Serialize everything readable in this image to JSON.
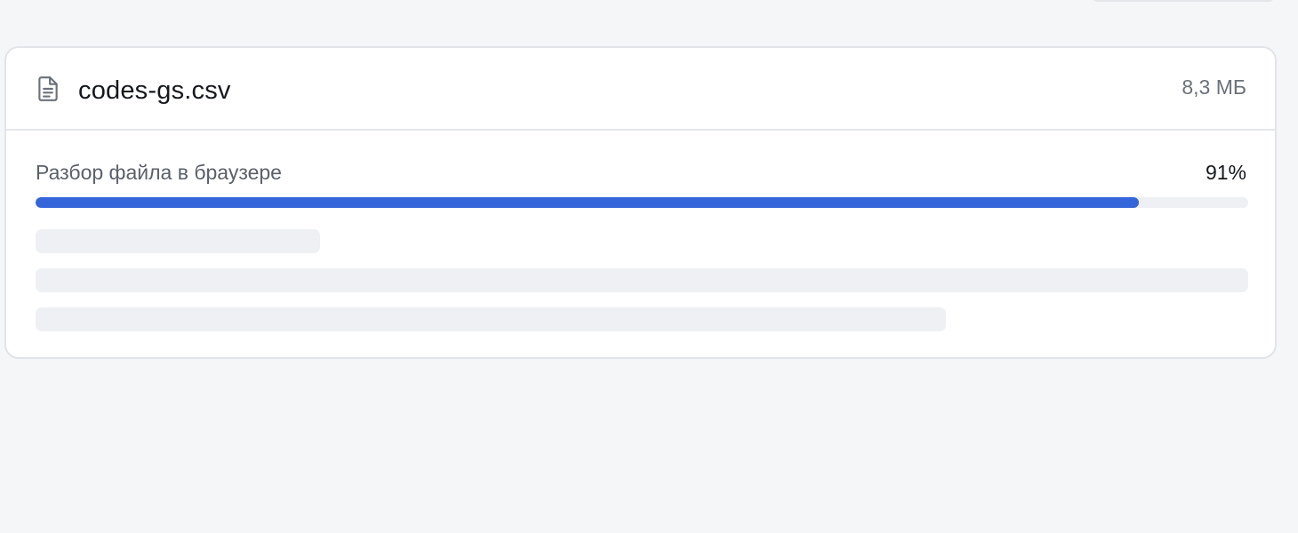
{
  "file": {
    "name": "codes-gs.csv",
    "size": "8,3 МБ",
    "icon": "file-text-icon"
  },
  "progress": {
    "label": "Разбор файла в браузере",
    "percent_text": "91%",
    "value": 0.91
  },
  "colors": {
    "accent": "#3465d9",
    "background": "#f5f6f8",
    "card": "#ffffff",
    "track": "#eff0f3",
    "skeleton": "#eff0f4"
  }
}
